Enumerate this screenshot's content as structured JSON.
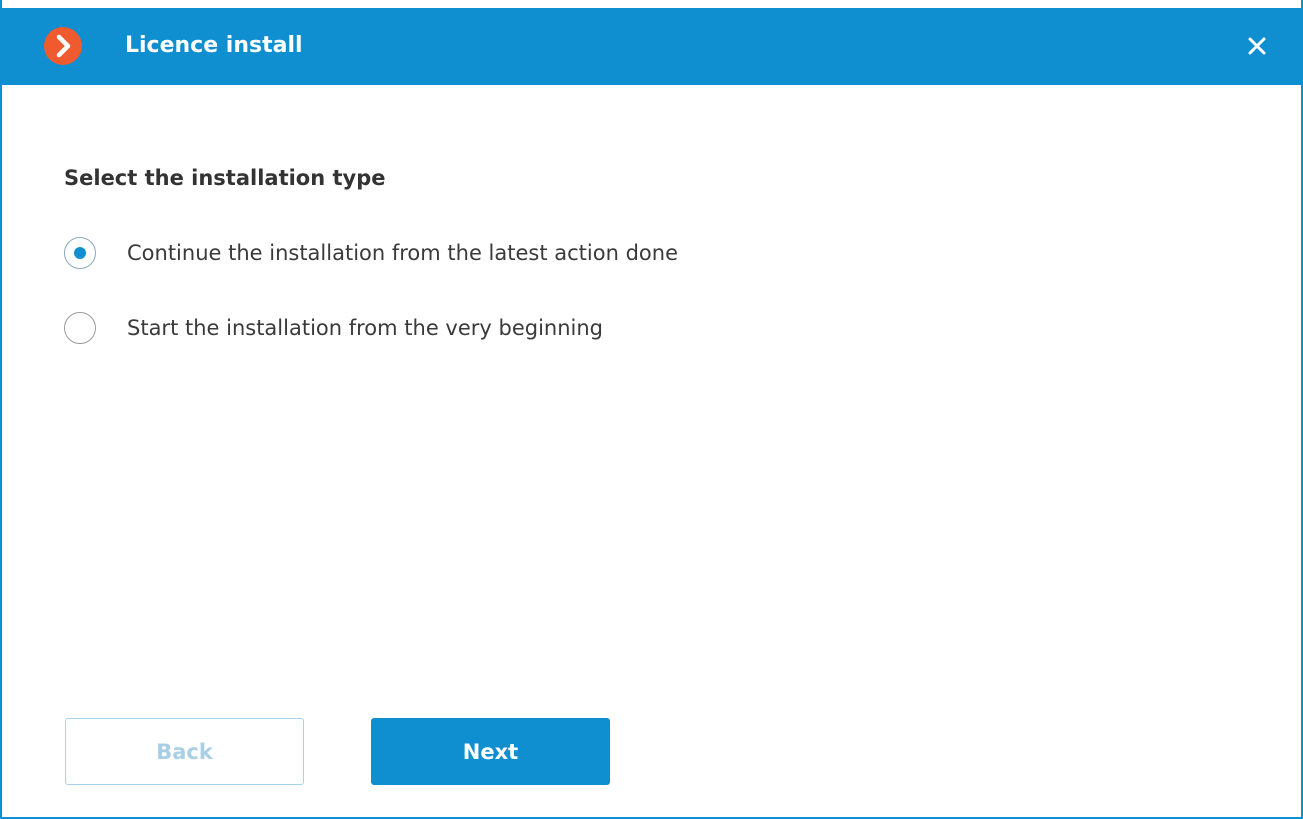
{
  "window": {
    "title": "Licence install",
    "logo_icon": "chevron-right-icon",
    "close_icon": "close-icon"
  },
  "content": {
    "heading": "Select the installation type",
    "options": [
      {
        "label": "Continue the installation from the latest action done",
        "selected": true
      },
      {
        "label": "Start the installation from the very beginning",
        "selected": false
      }
    ]
  },
  "footer": {
    "back_label": "Back",
    "back_enabled": false,
    "next_label": "Next"
  },
  "colors": {
    "accent": "#0f8ed0",
    "logo": "#ef5b2e",
    "disabled_text": "#a8cfe4"
  }
}
